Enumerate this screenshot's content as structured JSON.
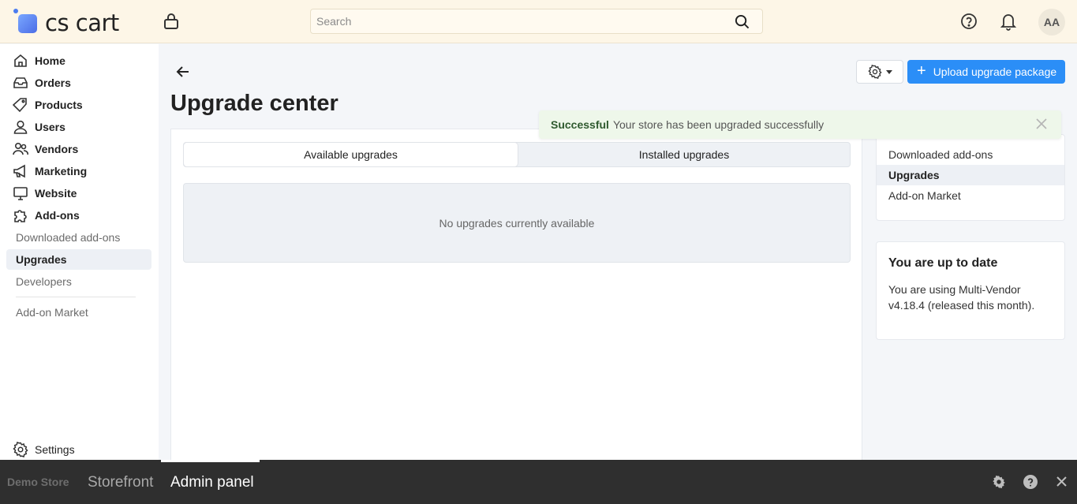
{
  "header": {
    "logo_text": "cs cart",
    "search_placeholder": "Search",
    "avatar_initials": "AA"
  },
  "sidebar": {
    "items": [
      {
        "label": "Home",
        "icon": "home-icon"
      },
      {
        "label": "Orders",
        "icon": "orders-icon"
      },
      {
        "label": "Products",
        "icon": "tag-icon"
      },
      {
        "label": "Users",
        "icon": "user-icon"
      },
      {
        "label": "Vendors",
        "icon": "vendors-icon"
      },
      {
        "label": "Marketing",
        "icon": "megaphone-icon"
      },
      {
        "label": "Website",
        "icon": "monitor-icon"
      },
      {
        "label": "Add-ons",
        "icon": "puzzle-icon"
      }
    ],
    "sub_items": [
      {
        "label": "Downloaded add-ons",
        "active": false
      },
      {
        "label": "Upgrades",
        "active": true
      },
      {
        "label": "Developers",
        "active": false
      },
      {
        "label": "Add-on Market",
        "active": false
      }
    ],
    "settings_label": "Settings"
  },
  "main": {
    "title": "Upgrade center",
    "upload_button": "Upload upgrade package",
    "tabs": [
      {
        "label": "Available upgrades",
        "active": true
      },
      {
        "label": "Installed upgrades",
        "active": false
      }
    ],
    "empty_message": "No upgrades currently available"
  },
  "notification": {
    "title": "Successful",
    "message": "Your store has been upgraded successfully"
  },
  "side_menu": {
    "items": [
      {
        "label": "Downloaded add-ons",
        "active": false
      },
      {
        "label": "Upgrades",
        "active": true
      },
      {
        "label": "Add-on Market",
        "active": false
      }
    ]
  },
  "status_card": {
    "title": "You are up to date",
    "body": "You are using Multi-Vendor v4.18.4 (released this month)."
  },
  "bottom_bar": {
    "store_name": "Demo Store",
    "storefront": "Storefront",
    "admin_panel": "Admin panel"
  },
  "colors": {
    "accent": "#2b8ef7",
    "header_bg": "#fdf6e7",
    "toast_bg": "#eef7ea",
    "bottom_bar_bg": "#2f2f2f"
  }
}
